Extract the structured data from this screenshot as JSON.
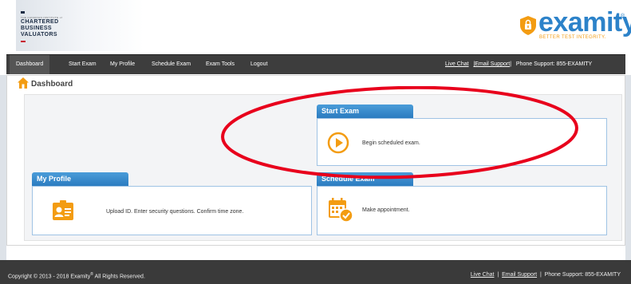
{
  "header": {
    "client_logo": {
      "small": "THE CANADIAN INSTITUTE of",
      "line1": "CHARTERED",
      "line2": "BUSINESS",
      "line3": "VALUATORS"
    },
    "brand": {
      "name": "examity",
      "reg": "®",
      "tagline": "BETTER TEST INTEGRITY."
    }
  },
  "nav": {
    "items": [
      {
        "label": "Dashboard",
        "active": true
      },
      {
        "label": "Start Exam"
      },
      {
        "label": "My Profile"
      },
      {
        "label": "Schedule Exam"
      },
      {
        "label": "Exam Tools"
      },
      {
        "label": "Logout"
      }
    ],
    "right": {
      "live_chat": "Live Chat",
      "email_support": "|Email Support",
      "separator": "|",
      "phone": "Phone Support: 855-EXAMITY"
    }
  },
  "dashboard": {
    "title": "Dashboard"
  },
  "cards": {
    "start_exam": {
      "title": "Start Exam",
      "text": "Begin scheduled exam."
    },
    "my_profile": {
      "title": "My Profile",
      "text": "Upload ID. Enter security questions. Confirm time zone."
    },
    "schedule_exam": {
      "title": "Schedule Exam",
      "text": "Make appointment."
    }
  },
  "footer": {
    "copyright": "Copyright © 2013 - 2018 Examity",
    "reg": "®",
    "rights": "All Rights Reserved.",
    "live_chat": "Live Chat",
    "sep1": "|",
    "email_support": "Email Support",
    "sep2": "|",
    "phone": "Phone Support: 855-EXAMITY"
  },
  "colors": {
    "accent": "#2c82c9",
    "orange": "#f39c12",
    "annotation": "#e8001c",
    "nav_bg": "#3d3d3d"
  }
}
